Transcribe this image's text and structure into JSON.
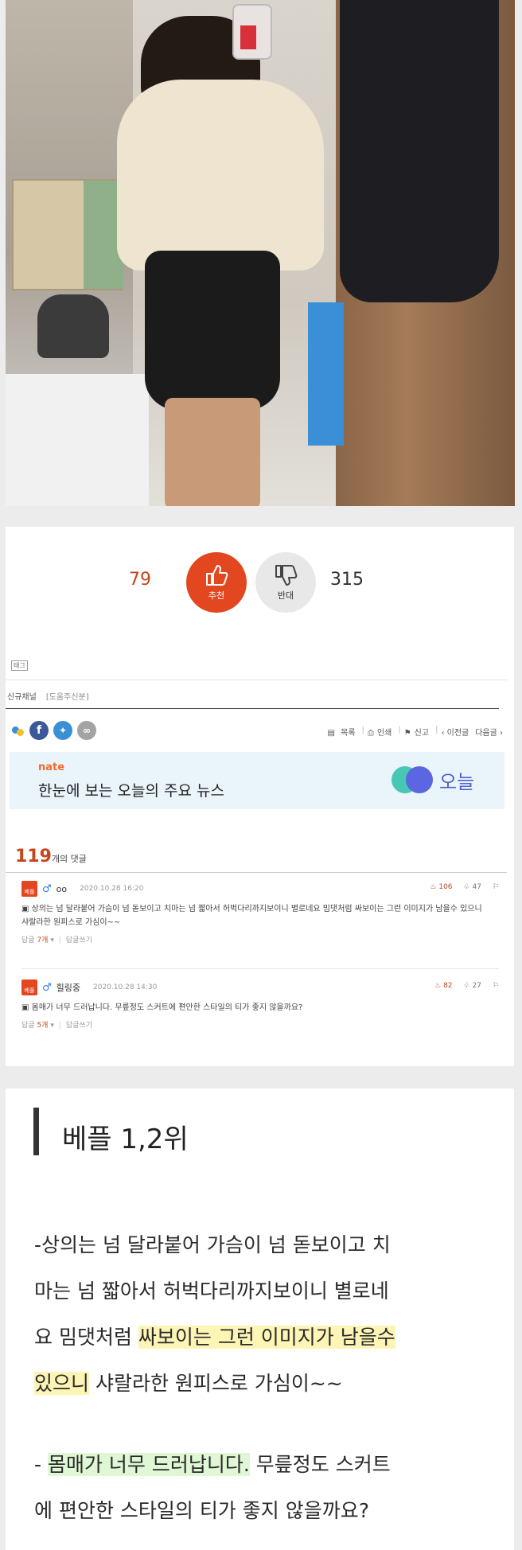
{
  "vote": {
    "up_count": "79",
    "up_label": "추천",
    "down_label": "반대",
    "down_count": "315"
  },
  "tag_label": "태그",
  "channel": {
    "label": "신규채널",
    "sub": "[도움주신분]"
  },
  "tools": {
    "list": "목록",
    "print": "인쇄",
    "report": "신고",
    "prev": "‹ 이전글",
    "next": "다음글 ›"
  },
  "nate": {
    "logo": "nate",
    "title": "한눈에 보는 오늘의 주요 뉴스",
    "today": "오늘"
  },
  "comments": {
    "count": "119",
    "count_suffix": "개의 댓글",
    "items": [
      {
        "badge": "베플",
        "nick": "oo",
        "date": "2020.10.28 16:20",
        "likes": "106",
        "dislikes": "47",
        "body": "상의는 넘 달라붙어 가슴이 넘 돋보이고 치마는 넘 짧아서 허벅다리까지보이니 별로네요 밈댓처럼 싸보이는 그런 이미지가 남을수 있으니 샤랄라한 원피스로 가심이~~",
        "reply_label": "답글",
        "reply_count": "7개",
        "write_label": "답글쓰기"
      },
      {
        "badge": "베플",
        "nick": "힐링중",
        "date": "2020.10.28 14:30",
        "likes": "82",
        "dislikes": "27",
        "body": "몸매가 너무 드러납니다. 무릎정도 스커트에 편안한 스타일의 티가 좋지 않을까요?",
        "reply_label": "답글",
        "reply_count": "5개",
        "write_label": "답글쓰기"
      }
    ]
  },
  "summary": {
    "heading": "베플 1,2위",
    "p1": {
      "l1": "-상의는 넘 달라붙어 가슴이 넘 돋보이고 치",
      "l2": "마는 넘 짧아서 허벅다리까지보이니 별로네",
      "l3a": "요 밈댓처럼 ",
      "l3b": "싸보이는 그런 이미지가 남을수",
      "l4a": "있으니",
      "l4b": " 샤랄라한 원피스로 가심이~~"
    },
    "p2": {
      "l1a": "- ",
      "l1b": "몸매가 너무 드러납니다.",
      "l1c": " 무릎정도 스커트",
      "l2": "에 편안한 스타일의 티가 좋지 않을까요?"
    }
  }
}
